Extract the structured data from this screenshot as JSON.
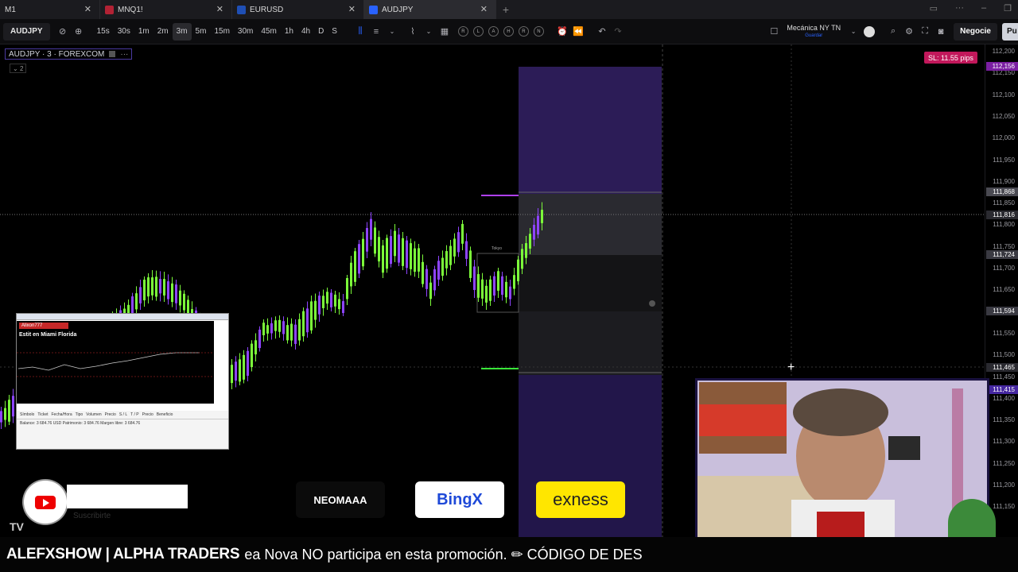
{
  "tabs": [
    {
      "label": "M1",
      "favicon": "#3a3a3a"
    },
    {
      "label": "MNQ1!",
      "favicon": "#b22234"
    },
    {
      "label": "EURUSD",
      "favicon": "#1f4fb5"
    },
    {
      "label": "AUDJPY",
      "favicon": "#2962ff",
      "active": true
    }
  ],
  "toolbar": {
    "symbol": "AUDJPY",
    "timeframes": [
      "15s",
      "30s",
      "1m",
      "2m",
      "3m",
      "5m",
      "15m",
      "30m",
      "45m",
      "1h",
      "4h",
      "D",
      "S"
    ],
    "active_timeframe": "3m",
    "replay_buttons": [
      "R",
      "L",
      "A",
      "H",
      "R",
      "N"
    ],
    "layout_name": "Mecánica NY TN",
    "layout_sub": "Guardar",
    "trade_button": "Negocie",
    "publish_button": "Pu"
  },
  "chart": {
    "legend": "AUDJPY · 3 · FOREXCOM",
    "indicator_count": "2",
    "sl_badge": "SL: 11.55 pips",
    "session_label": "Tokyo",
    "price_labels": [
      "112,200",
      "112,150",
      "112,100",
      "112,050",
      "112,000",
      "111,950",
      "111,900",
      "111,850",
      "111,800",
      "111,750",
      "111,700",
      "111,650",
      "111,600",
      "111,550",
      "111,500",
      "111,450",
      "111,400",
      "111,350",
      "111,300",
      "111,250",
      "111,200",
      "111,150"
    ],
    "price_tags": [
      {
        "text": "112,156",
        "color": "#7b1fa2"
      },
      {
        "text": "111,868",
        "color": "#4a4a52"
      },
      {
        "text": "111,816",
        "color": "#2a2a30"
      },
      {
        "text": "111,724",
        "color": "#3a3a42"
      },
      {
        "text": "111,594",
        "color": "#3a3a42"
      },
      {
        "text": "111,465",
        "color": "#2a2a30"
      },
      {
        "text": "111,415",
        "color": "#4527a0"
      }
    ]
  },
  "mini_window": {
    "user": "Alixon777",
    "location": "Estit en Miami Florida",
    "tabs": [
      "Símbolo",
      "Ticket",
      "Fecha/Hora",
      "Tipo",
      "Volumen",
      "Precio",
      "S / L",
      "T / P",
      "Precio",
      "Beneficio"
    ],
    "balance": "Balance: 3 684.76 USD  Patrimonio: 3 684.76  Margen libre: 3 684.76"
  },
  "overlay": {
    "subscribe": "Suscribirte",
    "sponsors": [
      {
        "name": "NEOMAAA",
        "bg": "#0b0b0b",
        "fg": "#ffffff"
      },
      {
        "name": "BingX",
        "bg": "#ffffff",
        "fg": "#1e49d8"
      },
      {
        "name": "exness",
        "bg": "#ffe600",
        "fg": "#222222"
      }
    ],
    "ticker_brand": "ALEFXSHOW | ALPHA TRADERS",
    "ticker_text": "ea Nova NO participa en esta promoción. ✏ CÓDIGO DE DES"
  }
}
